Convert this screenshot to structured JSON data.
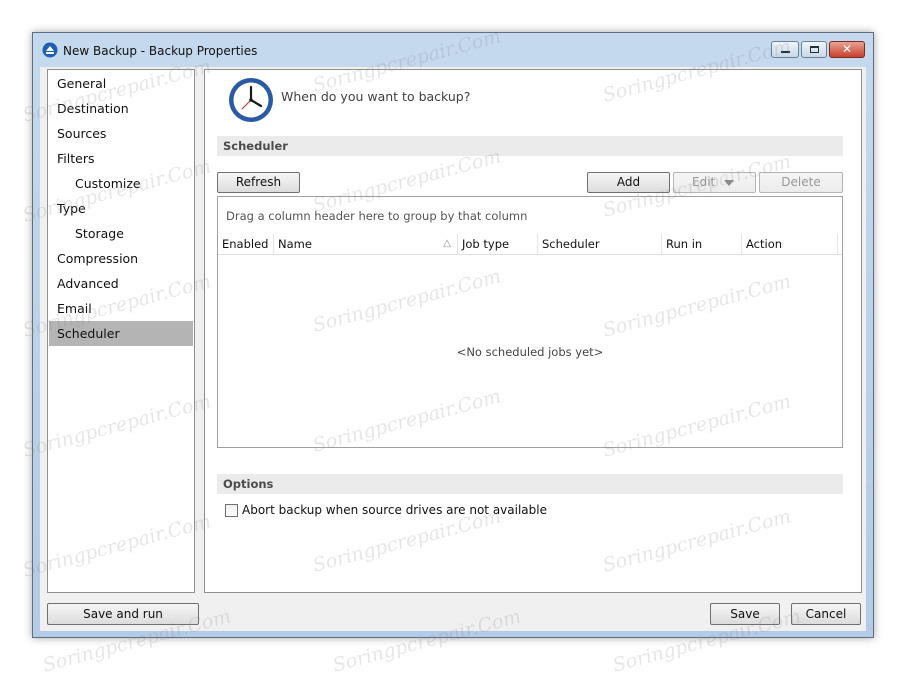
{
  "window": {
    "title": "New Backup - Backup Properties"
  },
  "nav": {
    "items": [
      {
        "label": "General",
        "selected": false,
        "sub": false
      },
      {
        "label": "Destination",
        "selected": false,
        "sub": false
      },
      {
        "label": "Sources",
        "selected": false,
        "sub": false
      },
      {
        "label": "Filters",
        "selected": false,
        "sub": false
      },
      {
        "label": "Customize",
        "selected": false,
        "sub": true
      },
      {
        "label": "Type",
        "selected": false,
        "sub": false
      },
      {
        "label": "Storage",
        "selected": false,
        "sub": true
      },
      {
        "label": "Compression",
        "selected": false,
        "sub": false
      },
      {
        "label": "Advanced",
        "selected": false,
        "sub": false
      },
      {
        "label": "Email",
        "selected": false,
        "sub": false
      },
      {
        "label": "Scheduler",
        "selected": true,
        "sub": false
      }
    ]
  },
  "content": {
    "question": "When do you want to backup?",
    "scheduler_header": "Scheduler",
    "buttons": {
      "refresh": "Refresh",
      "add": "Add",
      "edit": "Edit",
      "delete": "Delete"
    },
    "grid": {
      "group_hint": "Drag a column header here to group by that column",
      "columns": [
        "Enabled",
        "Name",
        "Job type",
        "Scheduler",
        "Run in",
        "Action"
      ],
      "empty_message": "<No scheduled jobs yet>"
    },
    "options_header": "Options",
    "abort_option": {
      "label": "Abort backup when source drives are not available",
      "checked": false
    }
  },
  "footer": {
    "save_and_run": "Save and run",
    "save": "Save",
    "cancel": "Cancel"
  },
  "watermark": "Soringpcrepair.Com",
  "colors": {
    "selected_nav": "#b4b4b4",
    "window_frame": "#b9cfe8",
    "clock_blue": "#2a5aa3"
  }
}
